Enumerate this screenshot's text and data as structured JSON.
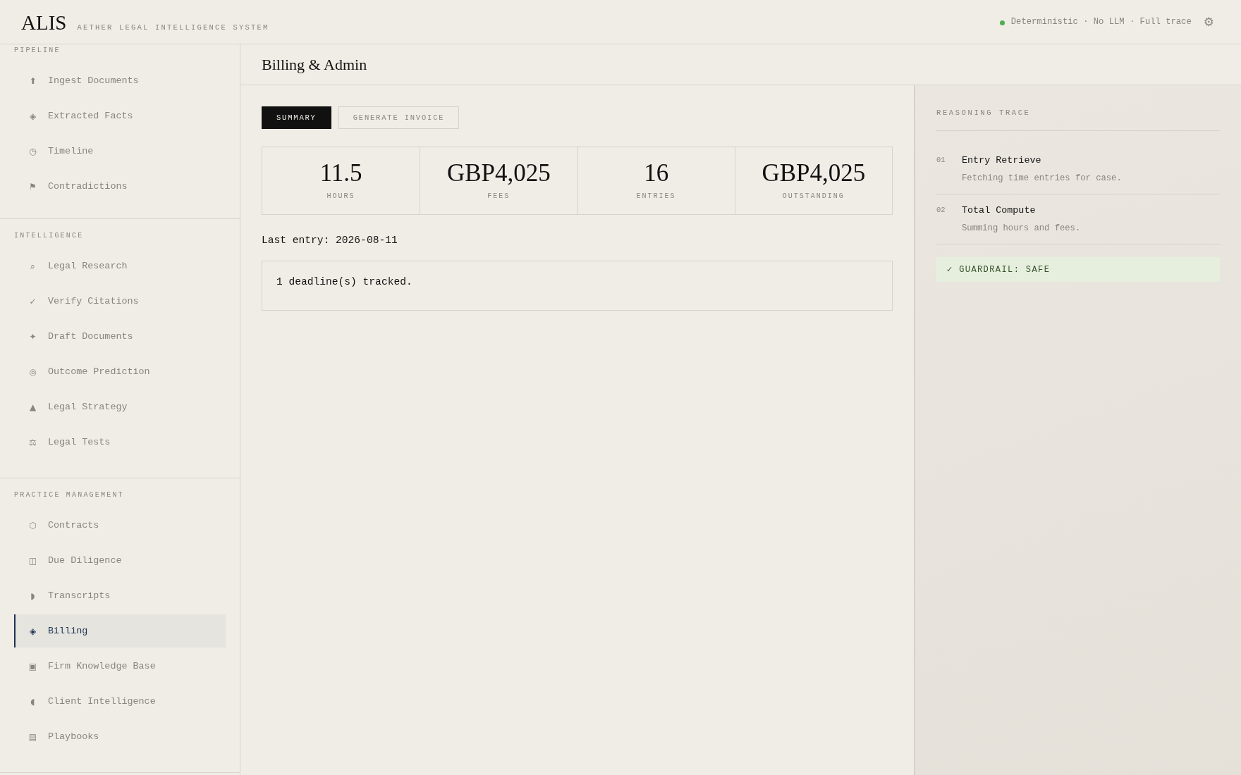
{
  "header": {
    "logo": "ALIS",
    "subtitle": "AETHER LEGAL INTELLIGENCE SYSTEM",
    "status": "Deterministic · No LLM · Full trace",
    "settings_icon": "⚙"
  },
  "sidebar": {
    "sections": [
      {
        "label": "PIPELINE",
        "items": [
          {
            "icon": "⬆",
            "label": "Ingest Documents",
            "selected": false
          },
          {
            "icon": "◈",
            "label": "Extracted Facts",
            "selected": false
          },
          {
            "icon": "◷",
            "label": "Timeline",
            "selected": false
          },
          {
            "icon": "⚑",
            "label": "Contradictions",
            "selected": false
          }
        ]
      },
      {
        "label": "INTELLIGENCE",
        "items": [
          {
            "icon": "⌕",
            "label": "Legal Research",
            "selected": false
          },
          {
            "icon": "✓",
            "label": "Verify Citations",
            "selected": false
          },
          {
            "icon": "✦",
            "label": "Draft Documents",
            "selected": false
          },
          {
            "icon": "◎",
            "label": "Outcome Prediction",
            "selected": false
          },
          {
            "icon": "▲",
            "label": "Legal Strategy",
            "selected": false
          },
          {
            "icon": "⚖",
            "label": "Legal Tests",
            "selected": false
          }
        ]
      },
      {
        "label": "PRACTICE MANAGEMENT",
        "items": [
          {
            "icon": "⬡",
            "label": "Contracts",
            "selected": false
          },
          {
            "icon": "◫",
            "label": "Due Diligence",
            "selected": false
          },
          {
            "icon": "◗",
            "label": "Transcripts",
            "selected": false
          },
          {
            "icon": "◈",
            "label": "Billing",
            "selected": true
          },
          {
            "icon": "▣",
            "label": "Firm Knowledge Base",
            "selected": false
          },
          {
            "icon": "◖",
            "label": "Client Intelligence",
            "selected": false
          },
          {
            "icon": "▤",
            "label": "Playbooks",
            "selected": false
          }
        ]
      }
    ]
  },
  "page": {
    "title": "Billing & Admin"
  },
  "tabs": [
    {
      "label": "SUMMARY",
      "selected": true
    },
    {
      "label": "GENERATE INVOICE",
      "selected": false
    }
  ],
  "stats": [
    {
      "value": "11.5",
      "label": "HOURS"
    },
    {
      "value": "GBP4,025",
      "label": "FEES"
    },
    {
      "value": "16",
      "label": "ENTRIES"
    },
    {
      "value": "GBP4,025",
      "label": "OUTSTANDING"
    }
  ],
  "last_entry": "Last entry: 2026-08-11",
  "notice": "1 deadline(s) tracked.",
  "trace": {
    "title": "REASONING TRACE",
    "steps": [
      {
        "number": "01",
        "title": "Entry Retrieve",
        "description": "Fetching time entries for case."
      },
      {
        "number": "02",
        "title": "Total Compute",
        "description": "Summing hours and fees."
      }
    ],
    "guardrail": {
      "icon": "✓",
      "text": "GUARDRAIL: SAFE"
    }
  }
}
